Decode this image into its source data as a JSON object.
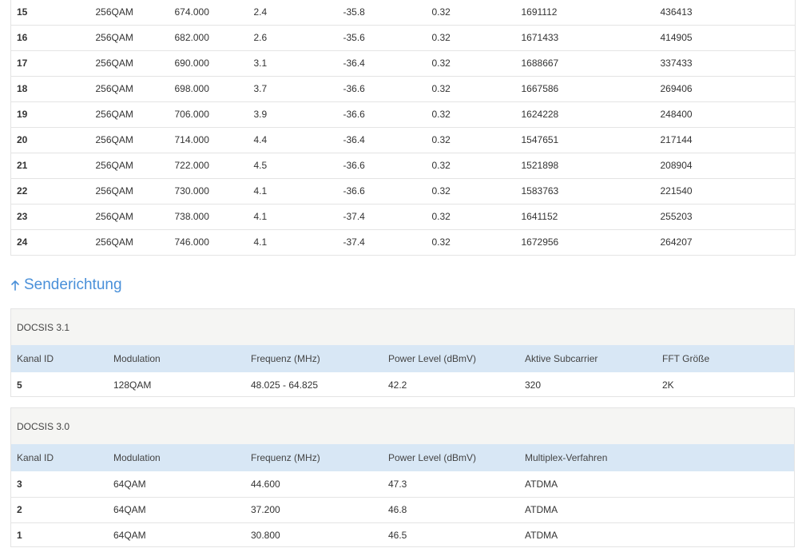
{
  "downstream": {
    "rows": [
      [
        "15",
        "256QAM",
        "674.000",
        "2.4",
        "-35.8",
        "0.32",
        "1691112",
        "436413"
      ],
      [
        "16",
        "256QAM",
        "682.000",
        "2.6",
        "-35.6",
        "0.32",
        "1671433",
        "414905"
      ],
      [
        "17",
        "256QAM",
        "690.000",
        "3.1",
        "-36.4",
        "0.32",
        "1688667",
        "337433"
      ],
      [
        "18",
        "256QAM",
        "698.000",
        "3.7",
        "-36.6",
        "0.32",
        "1667586",
        "269406"
      ],
      [
        "19",
        "256QAM",
        "706.000",
        "3.9",
        "-36.6",
        "0.32",
        "1624228",
        "248400"
      ],
      [
        "20",
        "256QAM",
        "714.000",
        "4.4",
        "-36.4",
        "0.32",
        "1547651",
        "217144"
      ],
      [
        "21",
        "256QAM",
        "722.000",
        "4.5",
        "-36.6",
        "0.32",
        "1521898",
        "208904"
      ],
      [
        "22",
        "256QAM",
        "730.000",
        "4.1",
        "-36.6",
        "0.32",
        "1583763",
        "221540"
      ],
      [
        "23",
        "256QAM",
        "738.000",
        "4.1",
        "-37.4",
        "0.32",
        "1641152",
        "255203"
      ],
      [
        "24",
        "256QAM",
        "746.000",
        "4.1",
        "-37.4",
        "0.32",
        "1672956",
        "264207"
      ]
    ]
  },
  "upstream": {
    "title": "Senderichtung",
    "arrow_icon": "arrow-up-icon",
    "accent_color": "#4a90d9",
    "docsis31": {
      "caption": "DOCSIS 3.1",
      "headers": [
        "Kanal ID",
        "Modulation",
        "Frequenz (MHz)",
        "Power Level (dBmV)",
        "Aktive Subcarrier",
        "FFT Größe"
      ],
      "rows": [
        [
          "5",
          "128QAM",
          "48.025 - 64.825",
          "42.2",
          "320",
          "2K"
        ]
      ]
    },
    "docsis30": {
      "caption": "DOCSIS 3.0",
      "headers": [
        "Kanal ID",
        "Modulation",
        "Frequenz (MHz)",
        "Power Level (dBmV)",
        "Multiplex-Verfahren"
      ],
      "rows": [
        [
          "3",
          "64QAM",
          "44.600",
          "47.3",
          "ATDMA"
        ],
        [
          "2",
          "64QAM",
          "37.200",
          "46.8",
          "ATDMA"
        ],
        [
          "1",
          "64QAM",
          "30.800",
          "46.5",
          "ATDMA"
        ]
      ]
    }
  }
}
